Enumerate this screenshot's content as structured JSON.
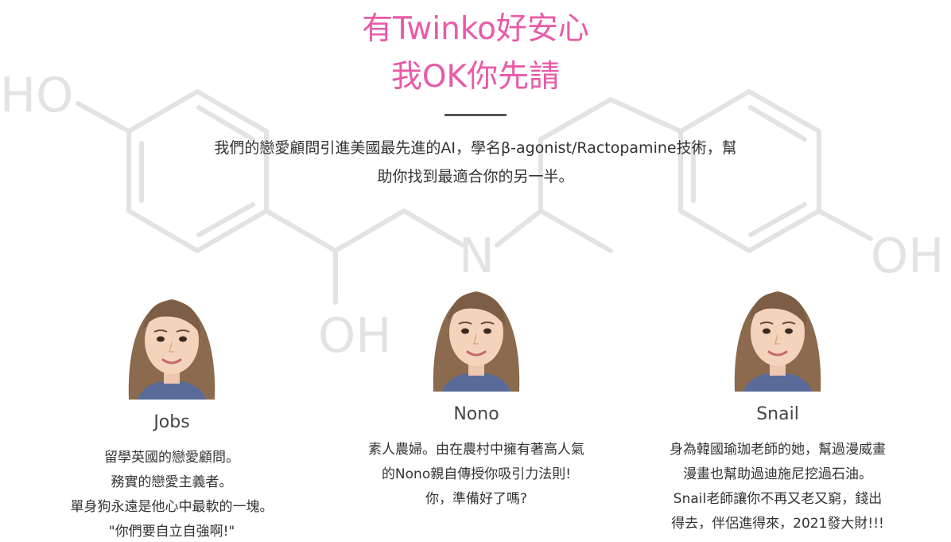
{
  "background": {
    "labels": [
      "HO",
      "N",
      "OH",
      "OH"
    ]
  },
  "header": {
    "title_line1": "有Twinko好安心",
    "title_line2": "我OK你先請",
    "intro_line1": "我們的戀愛顧問引進美國最先進的AI，學名β-agonist/Ractopamine技術，幫",
    "intro_line2": "助你找到最適合你的另一半。"
  },
  "members": [
    {
      "name": "Jobs",
      "lines": [
        "留學英國的戀愛顧問。",
        "務實的戀愛主義者。",
        "單身狗永遠是他心中最軟的一塊。",
        "\"你們要自立自強啊!\""
      ]
    },
    {
      "name": "Nono",
      "lines": [
        "素人農婦。由在農村中擁有著高人氣",
        "的Nono親自傳授你吸引力法則!",
        "你，準備好了嗎?"
      ]
    },
    {
      "name": "Snail",
      "lines": [
        "身為韓國瑜珈老師的她，幫過漫威畫",
        "漫畫也幫助過迪施尼挖過石油。",
        "Snail老師讓你不再又老又窮，錢出",
        "得去，伴侶進得來，2021發大財!!!"
      ]
    }
  ],
  "colors": {
    "accent": "#e85aa8",
    "text": "#333333",
    "background_art": "#e3e3e3"
  }
}
